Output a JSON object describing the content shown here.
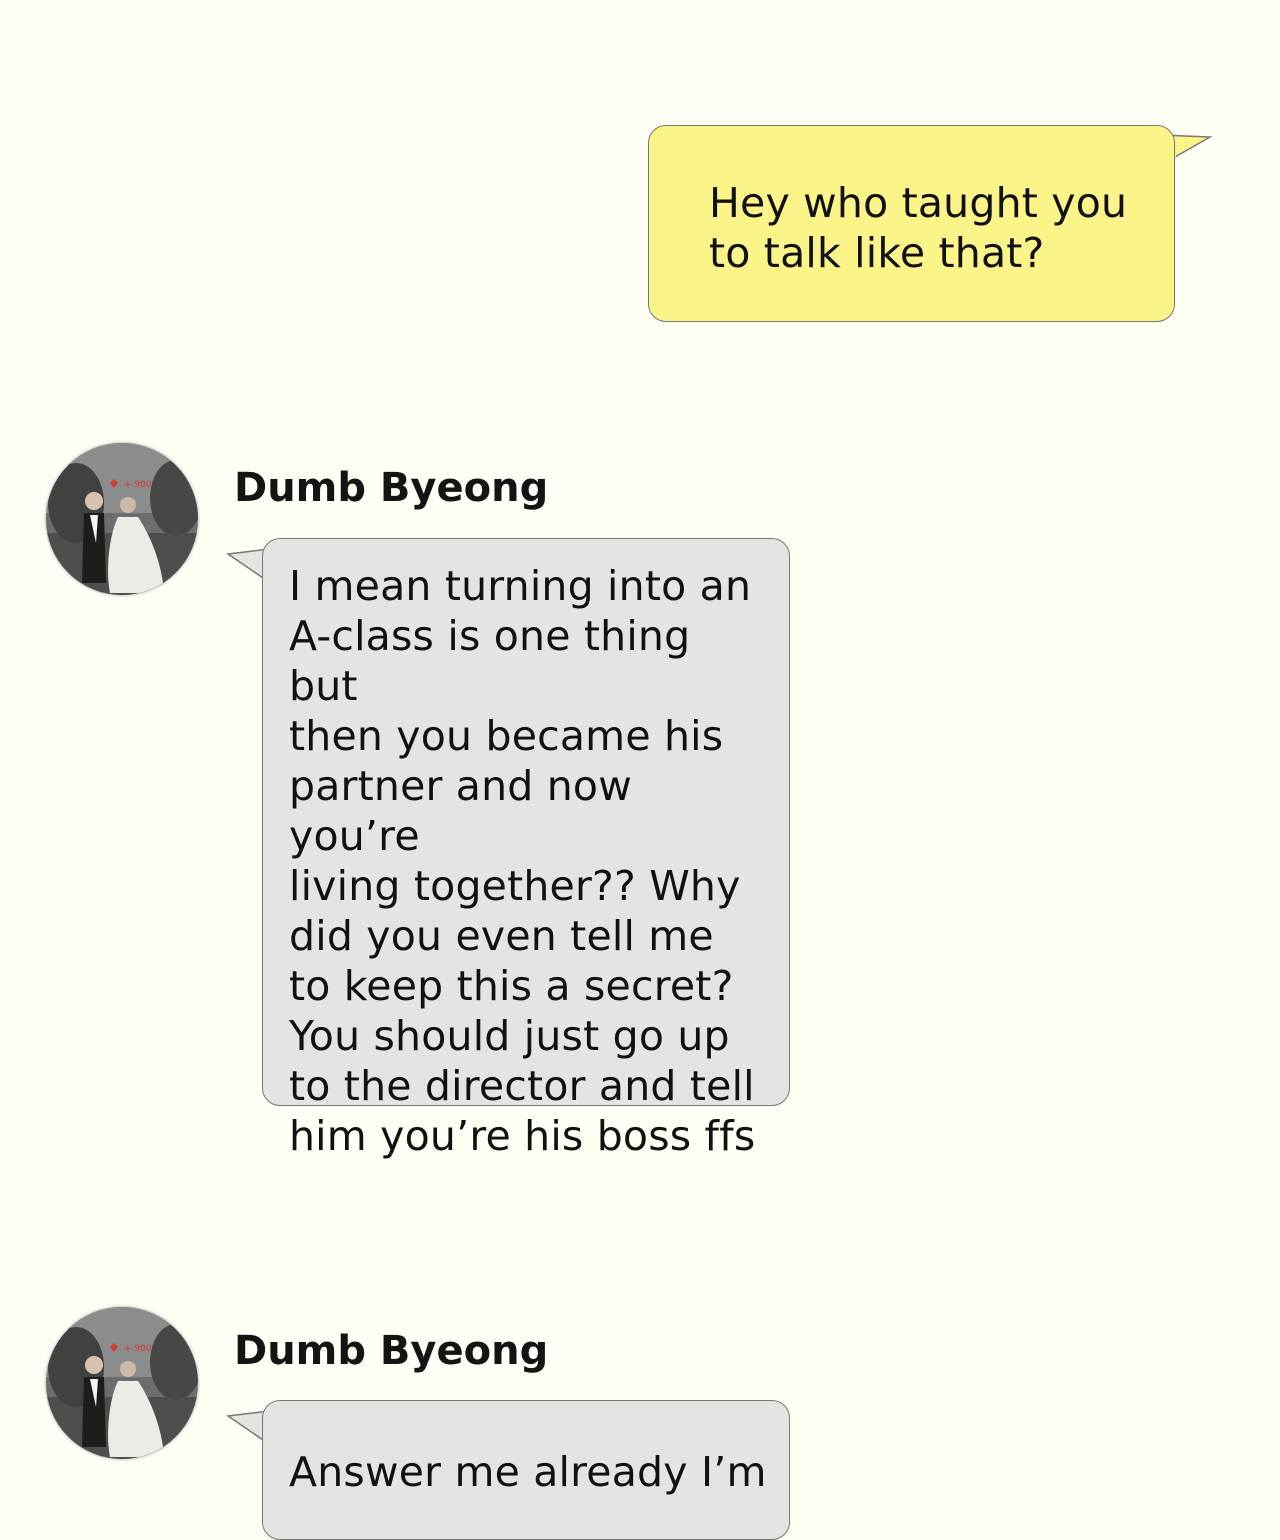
{
  "messages": [
    {
      "direction": "outgoing",
      "text": "Hey who taught you\nto talk like that?"
    },
    {
      "direction": "incoming",
      "sender": "Dumb Byeong",
      "avatar_icon": "couple-wedding-photo-avatar",
      "text": "I mean turning into an\nA-class is one thing but\nthen you became his\npartner and now you’re\nliving together?? Why\ndid you even tell me\nto keep this a secret?\nYou should just go up\nto the director and tell\nhim you’re his boss ffs"
    },
    {
      "direction": "incoming",
      "sender": "Dumb Byeong",
      "avatar_icon": "couple-wedding-photo-avatar",
      "text": "Answer me already I’m"
    }
  ],
  "colors": {
    "background": "#fefff4",
    "outgoing_bubble": "#fbf488",
    "incoming_bubble": "#e4e4e3",
    "bubble_border": "#777777"
  }
}
